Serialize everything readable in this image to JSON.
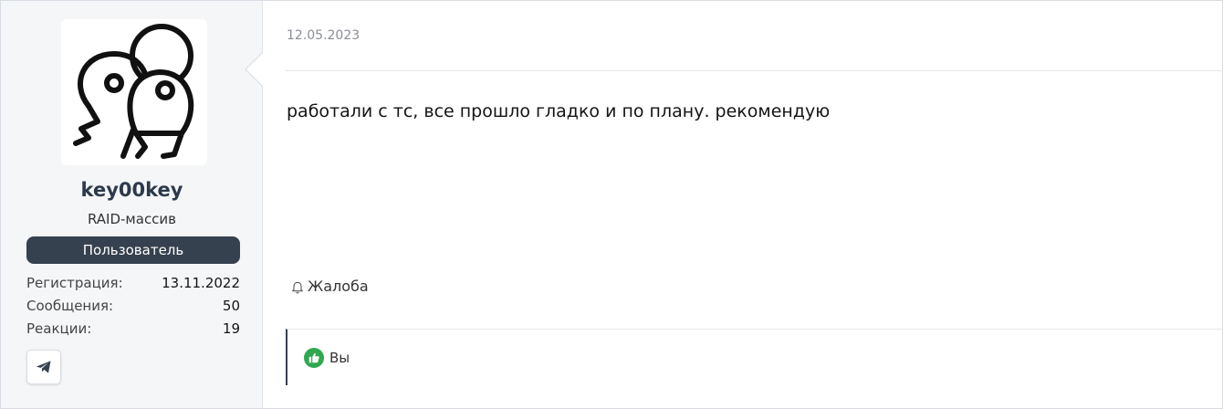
{
  "post": {
    "user": {
      "name": "key00key",
      "title": "RAID-массив",
      "banner": "Пользователь",
      "stats": [
        {
          "label": "Регистрация:",
          "value": "13.11.2022"
        },
        {
          "label": "Сообщения:",
          "value": "50"
        },
        {
          "label": "Реакции:",
          "value": "19"
        }
      ],
      "avatar_icon": "keys-icon",
      "contact_icon": "telegram-icon"
    },
    "date": "12.05.2023",
    "message": "работали с тс, все прошло гладко и по плану. рекомендую",
    "report_label": "Жалоба",
    "report_icon": "bell-icon",
    "reactions": {
      "icon": "thumbs-up-icon",
      "text": "Вы"
    }
  },
  "colors": {
    "banner": "#36414f",
    "like": "#2fa84f",
    "sidebar_bg": "#f5f6f8"
  }
}
